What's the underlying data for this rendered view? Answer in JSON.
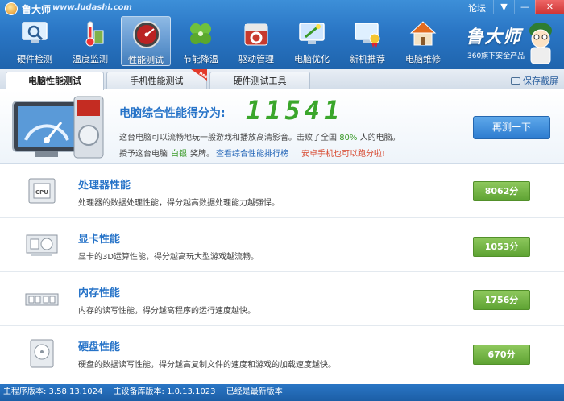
{
  "window": {
    "title": "鲁大师",
    "url": "www.ludashi.com",
    "forum": "论坛",
    "menu_glyph": "▼",
    "min_glyph": "—",
    "close_glyph": "✕"
  },
  "nav": [
    {
      "label": "硬件检测",
      "icon": "monitor-magnifier-icon"
    },
    {
      "label": "温度监测",
      "icon": "thermometer-icon"
    },
    {
      "label": "性能测试",
      "icon": "speedometer-icon",
      "active": true
    },
    {
      "label": "节能降温",
      "icon": "leaf-clover-icon"
    },
    {
      "label": "驱动管理",
      "icon": "gear-box-icon"
    },
    {
      "label": "电脑优化",
      "icon": "monitor-wand-icon"
    },
    {
      "label": "新机推荐",
      "icon": "monitor-medal-icon"
    },
    {
      "label": "电脑维修",
      "icon": "house-icon"
    }
  ],
  "brand": {
    "name": "鲁大师",
    "sub": "360旗下安全产品"
  },
  "tabs": [
    {
      "label": "电脑性能测试",
      "active": true
    },
    {
      "label": "手机性能测试",
      "badge": "new"
    },
    {
      "label": "硬件测试工具"
    }
  ],
  "save_screenshot": "保存截屏",
  "score": {
    "label": "电脑综合性能得分为:",
    "value": "11541",
    "desc_prefix": "这台电脑可以流畅地玩一般游戏和播放高清影音。击败了全国",
    "desc_pct": "80%",
    "desc_suffix": "人的电脑。",
    "award_prefix": "授予这台电脑",
    "award_medal": "白银",
    "award_suffix": "奖牌。",
    "rank_link": "查看综合性能排行榜",
    "mobile_link": "安卓手机也可以跑分啦!",
    "retest": "再测一下"
  },
  "metrics": [
    {
      "title": "处理器性能",
      "desc": "处理器的数据处理性能，得分越高数据处理能力越强悍。",
      "score": "8062分",
      "icon": "cpu-chip-icon"
    },
    {
      "title": "显卡性能",
      "desc": "显卡的3D运算性能，得分越高玩大型游戏越流畅。",
      "score": "1053分",
      "icon": "graphics-card-icon"
    },
    {
      "title": "内存性能",
      "desc": "内存的读写性能，得分越高程序的运行速度越快。",
      "score": "1756分",
      "icon": "memory-stick-icon"
    },
    {
      "title": "硬盘性能",
      "desc": "硬盘的数据读写性能，得分越高复制文件的速度和游戏的加载速度越快。",
      "score": "670分",
      "icon": "hard-disk-icon"
    }
  ],
  "status": {
    "program": "主程序版本: 3.58.13.1024",
    "device_db": "主设备库版本: 1.0.13.1023",
    "latest": "已经是最新版本"
  },
  "colors": {
    "accent_blue": "#2673c8",
    "score_green": "#3aa62b",
    "button_green": "#5ea333",
    "link_red": "#d7452b"
  }
}
